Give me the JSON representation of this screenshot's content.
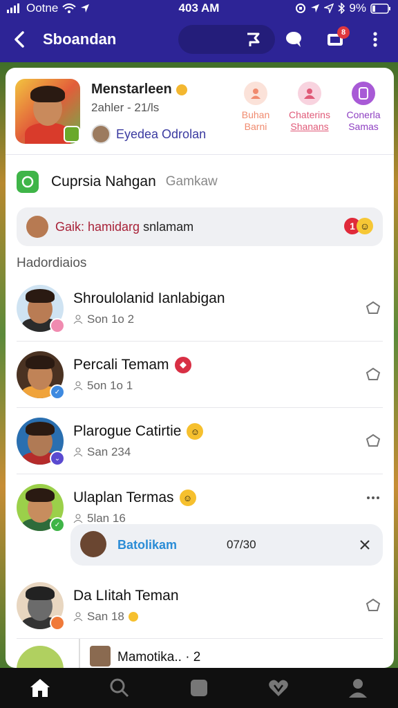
{
  "status": {
    "carrier": "Ootne",
    "time": "403 AM",
    "battery": "9%"
  },
  "appbar": {
    "title": "Sboandan",
    "notif_badge": "8"
  },
  "profile": {
    "name": "Menstarleen",
    "subtitle": "2ahler - 21/ls",
    "link": "Eyedea Odrolan",
    "actions": [
      {
        "line1": "Buhan",
        "line2": "Barni",
        "color": "#f08a6e"
      },
      {
        "line1": "Chaterins",
        "line2": "Shanans",
        "color": "#e05a78"
      },
      {
        "line1": "Conerla",
        "line2": "Samas",
        "color": "#8e3fc2"
      }
    ]
  },
  "section": {
    "title": "Cuprsia Nahgan",
    "hint": "Gamkaw"
  },
  "notice": {
    "highlight": "Gaik: hamidarg",
    "rest": "snlamam",
    "badge": "1"
  },
  "list_label": "Hadordiaios",
  "rows": [
    {
      "name": "Shroulolanid Ianlabigan",
      "sub": "Son 1o 2"
    },
    {
      "name": "Percali Temam",
      "sub": "5on 1o 1"
    },
    {
      "name": "Plarogue Catirtie",
      "sub": "San 234"
    },
    {
      "name": "Ulaplan Termas",
      "sub": "5lan 16"
    },
    {
      "name": "Da LIitah Teman",
      "sub": "San 18"
    }
  ],
  "reply": {
    "name": "Batolikam",
    "time": "07/30"
  },
  "thread": {
    "text": "Mamotika.. · 2"
  },
  "colors": {
    "brand": "#2d2496",
    "accent_red": "#e0383e",
    "green": "#3fb548"
  },
  "icons": [
    "back-icon",
    "flag-icon",
    "chat-icon",
    "inbox-icon",
    "more-icon",
    "home-icon",
    "search-icon",
    "square-icon",
    "heart-icon",
    "profile-icon"
  ]
}
